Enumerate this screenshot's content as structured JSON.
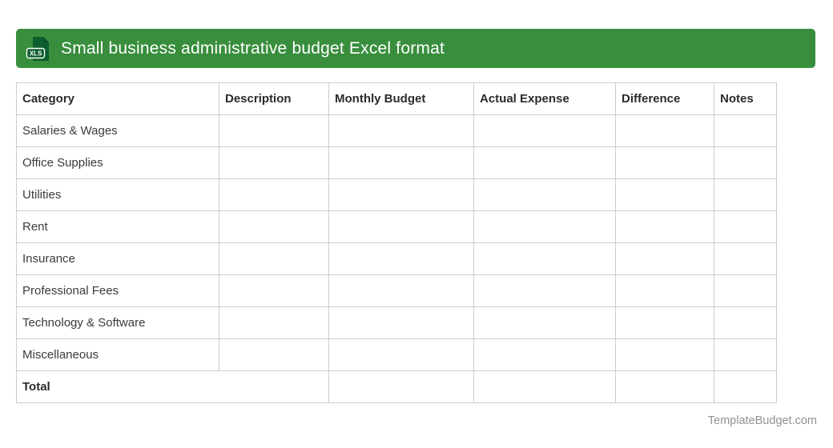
{
  "header": {
    "title": "Small business administrative budget Excel format",
    "icon_label": "XLS",
    "bar_color": "#388E3C",
    "icon_color": "#0B5E2D"
  },
  "table": {
    "columns": [
      "Category",
      "Description",
      "Monthly Budget",
      "Actual Expense",
      "Difference",
      "Notes"
    ],
    "rows": [
      "Salaries & Wages",
      "Office Supplies",
      "Utilities",
      "Rent",
      "Insurance",
      "Professional Fees",
      "Technology & Software",
      "Miscellaneous"
    ],
    "total_label": "Total"
  },
  "footer": {
    "credit": "TemplateBudget.com"
  }
}
